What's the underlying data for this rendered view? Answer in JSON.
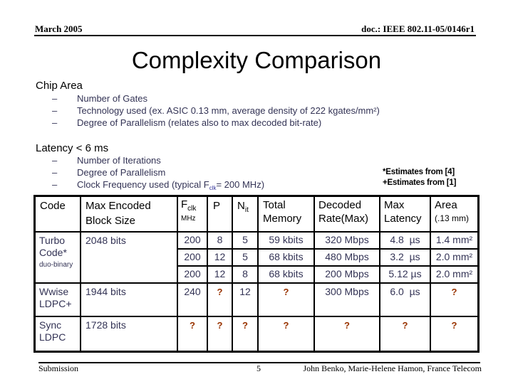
{
  "header": {
    "date": "March 2005",
    "doc_id": "doc.: IEEE 802.11-05/0146r1"
  },
  "title": "Complexity Comparison",
  "sections": [
    {
      "heading": "Chip Area",
      "bullets": [
        "Number of Gates",
        "Technology used (ex. ASIC 0.13 mm, average density of 222 kgates/mm²)",
        "Degree of Parallelism (relates also to max decoded bit-rate)"
      ]
    },
    {
      "heading": "Latency < 6 ms",
      "bullets": [
        "Number of Iterations",
        "Degree of Parallelism",
        "Clock Frequency used (typical  F"
      ],
      "clock_sub": "clk",
      "clock_tail": "= 200 MHz)"
    }
  ],
  "bullet_dash": "–",
  "notes": [
    "*Estimates from [4]",
    "+Estimates from [1]"
  ],
  "table": {
    "headers": {
      "code": "Code",
      "block_size_1": "Max Encoded",
      "block_size_2": "Block Size",
      "fclk_main": "F",
      "fclk_sub": "clk",
      "fclk_unit": "MHz",
      "p": "P",
      "nit_main": "N",
      "nit_sub": "it",
      "memory_1": "Total",
      "memory_2": "Memory",
      "rate_1": "Decoded",
      "rate_2": "Rate(Max)",
      "latency_1": "Max",
      "latency_2": "Latency",
      "area_1": "Area",
      "area_2": "(.13 mm)"
    },
    "turbo": {
      "code_1": "Turbo",
      "code_2": "Code*",
      "code_3": "duo-binary",
      "block_size": "2048 bits",
      "rows": [
        {
          "fclk": "200",
          "p": "8",
          "nit": "5",
          "memory": "59 kbits",
          "rate": "320 Mbps",
          "latency": "4.8  µs",
          "area": "1.4 mm²"
        },
        {
          "fclk": "200",
          "p": "12",
          "nit": "5",
          "memory": "68 kbits",
          "rate": "480 Mbps",
          "latency": "3.2  µs",
          "area": "2.0 mm²"
        },
        {
          "fclk": "200",
          "p": "12",
          "nit": "8",
          "memory": "68 kbits",
          "rate": "200 Mbps",
          "latency": "5.12 µs",
          "area": "2.0 mm²"
        }
      ]
    },
    "wwise": {
      "code_1": "Wwise",
      "code_2": "LDPC+",
      "block_size": "1944 bits",
      "fclk": "240",
      "p": "?",
      "nit": "12",
      "memory": "?",
      "rate": "300 Mbps",
      "latency": "6.0  µs",
      "area": "?"
    },
    "sync": {
      "code_1": "Sync",
      "code_2": "LDPC",
      "block_size": "1728 bits",
      "fclk": "?",
      "p": "?",
      "nit": "?",
      "memory": "?",
      "rate": "?",
      "latency": "?",
      "area": "?"
    }
  },
  "footer": {
    "left": "Submission",
    "page": "5",
    "authors": "John Benko, Marie-Helene Hamon,  France Telecom"
  },
  "colors": {
    "text_dark": "#000000",
    "body_text": "#333355",
    "unknown_mark": "#993300"
  }
}
